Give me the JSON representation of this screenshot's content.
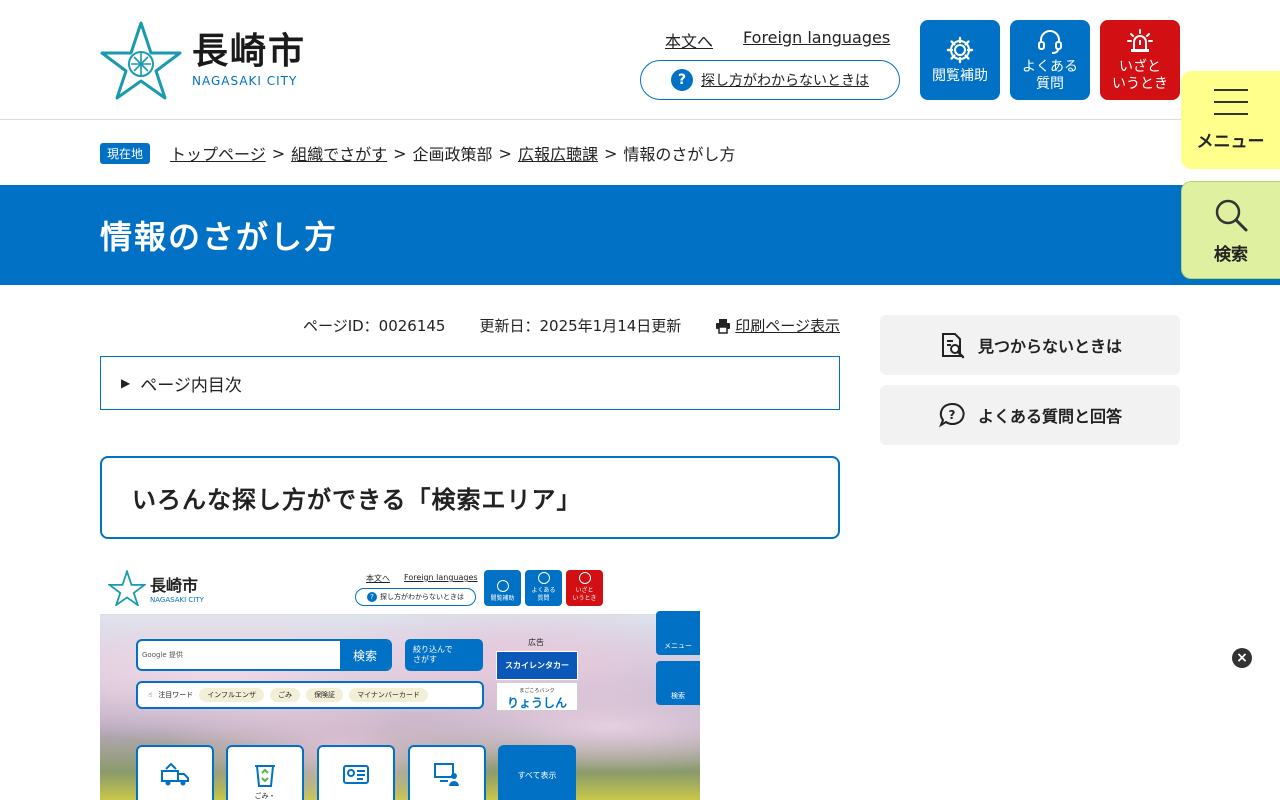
{
  "header": {
    "logo_ja": "長崎市",
    "logo_en": "NAGASAKI CITY",
    "links": [
      "本文へ",
      "Foreign languages"
    ],
    "help_label": "探し方がわからないときは",
    "buttons": [
      {
        "label": "閲覧補助",
        "icon": "gear-icon",
        "color": "#0071c5"
      },
      {
        "label": "よくある\n質問",
        "icon": "headset-icon",
        "color": "#0071c5"
      },
      {
        "label": "いざと\nいうとき",
        "icon": "siren-icon",
        "color": "#d20f12"
      }
    ]
  },
  "side_tabs": {
    "menu": "メニュー",
    "search": "検索"
  },
  "breadcrumb": {
    "badge": "現在地",
    "items": [
      "トップページ",
      "組織でさがす",
      "企画政策部",
      "広報広聴課",
      "情報のさがし方"
    ],
    "separator": ">"
  },
  "page": {
    "title": "情報のさがし方",
    "page_id": "ページID：0026145",
    "updated": "更新日：2025年1月14日更新",
    "print": "印刷ページ表示",
    "toc": "ページ内目次",
    "section_heading": "いろんな探し方ができる「検索エリア」"
  },
  "sidebar": {
    "cards": [
      "見つからないときは",
      "よくある質問と回答"
    ]
  },
  "screenshot_image": {
    "logo_ja": "長崎市",
    "logo_en": "NAGASAKI CITY",
    "links": [
      "本文へ",
      "Foreign languages"
    ],
    "help_label": "探し方がわからないときは",
    "buttons": [
      "閲覧補助",
      "よくある\n質問",
      "いざと\nいうとき"
    ],
    "search_placeholder": "Google 提供",
    "search_button": "検索",
    "narrow_button": "絞り込んで\nさがす",
    "ad_label": "広告",
    "ad1": "スカイレンタカー",
    "ad2_small": "まごころバンク",
    "ad2": "りょうしん",
    "keyword_label": "注目ワード",
    "keywords": [
      "インフルエンザ",
      "ごみ",
      "保険証",
      "マイナンバーカード"
    ],
    "side_menu": "メニュー",
    "side_search": "検索",
    "tile_label_2": "ごみ・",
    "show_all": "すべて表示"
  },
  "colors": {
    "accent": "#0071c5",
    "emergency": "#d20f12",
    "menu_tab": "#ffff8c",
    "search_tab": "#dff0a0"
  }
}
